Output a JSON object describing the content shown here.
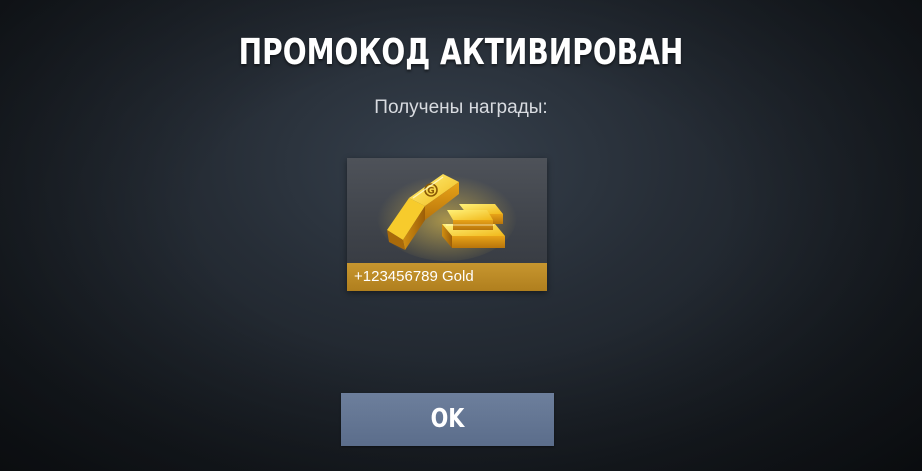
{
  "dialog": {
    "title": "ПРОМОКОД АКТИВИРОВАН",
    "subtitle": "Получены награды:"
  },
  "reward": {
    "icon": "gold-bars-icon",
    "label": "+123456789 Gold",
    "accent_color": "#c7962f"
  },
  "actions": {
    "ok_label": "OK",
    "ok_color": "#6d7f9c"
  }
}
